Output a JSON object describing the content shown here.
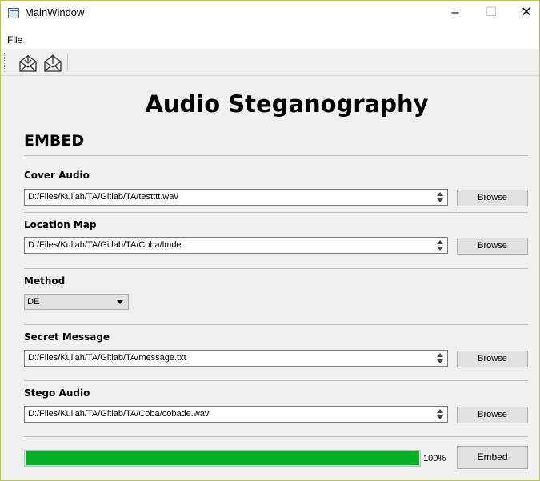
{
  "window": {
    "title": "MainWindow",
    "minimize_glyph": "–",
    "maximize_glyph": "☐",
    "close_glyph": "✕"
  },
  "menu": {
    "items": [
      {
        "label": "File"
      }
    ]
  },
  "toolbar": {
    "buttons": [
      {
        "icon": "envelope-download-icon"
      },
      {
        "icon": "envelope-upload-icon"
      }
    ]
  },
  "main": {
    "title": "Audio Steganography",
    "section": "EMBED",
    "cover_audio": {
      "label": "Cover Audio",
      "value": "D:/Files/Kuliah/TA/Gitlab/TA/testttt.wav",
      "button": "Browse"
    },
    "location_map": {
      "label": "Location Map",
      "value": "D:/Files/Kuliah/TA/Gitlab/TA/Coba/lmde",
      "button": "Browse"
    },
    "method": {
      "label": "Method",
      "selected": "DE"
    },
    "secret_message": {
      "label": "Secret Message",
      "value": "D:/Files/Kuliah/TA/Gitlab/TA/message.txt",
      "button": "Browse"
    },
    "stego_audio": {
      "label": "Stego Audio",
      "value": "D:/Files/Kuliah/TA/Gitlab/TA/Coba/cobade.wav",
      "button": "Browse"
    },
    "progress": {
      "value": 100,
      "text": "100%"
    },
    "embed_button": "Embed"
  },
  "colors": {
    "progress_fill": "#06b025",
    "window_border": "#b8c25a"
  }
}
